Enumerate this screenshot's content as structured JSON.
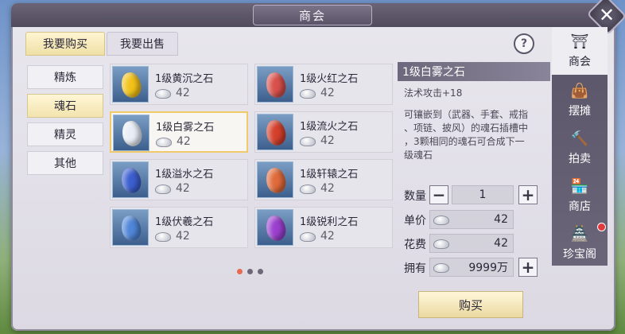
{
  "window": {
    "title": "商会",
    "close_icon": "close-icon"
  },
  "tabs": {
    "buy": "我要购买",
    "sell": "我要出售"
  },
  "help_label": "?",
  "categories": [
    {
      "label": "精炼",
      "active": false
    },
    {
      "label": "魂石",
      "active": true
    },
    {
      "label": "精灵",
      "active": false
    },
    {
      "label": "其他",
      "active": false
    }
  ],
  "items": [
    {
      "name": "1级黄沉之石",
      "price": "42",
      "gem_color": "#f2c21a"
    },
    {
      "name": "1级火红之石",
      "price": "42",
      "gem_color": "#d9504b"
    },
    {
      "name": "1级白雾之石",
      "price": "42",
      "gem_color": "#e8eef5",
      "selected": true
    },
    {
      "name": "1级流火之石",
      "price": "42",
      "gem_color": "#d5402c"
    },
    {
      "name": "1级溢水之石",
      "price": "42",
      "gem_color": "#3c5fd0"
    },
    {
      "name": "1级轩辕之石",
      "price": "42",
      "gem_color": "#e06a3a"
    },
    {
      "name": "1级伏羲之石",
      "price": "42",
      "gem_color": "#4f86d8"
    },
    {
      "name": "1级锐利之石",
      "price": "42",
      "gem_color": "#9a3fcf"
    }
  ],
  "pagination": {
    "pages": 3,
    "current": 1
  },
  "detail": {
    "title": "1级白雾之石",
    "attribute": "法术攻击+18",
    "description_lines": [
      "可镶嵌到（武器、手套、戒指",
      "、项链、披风）的魂石插槽中",
      "，3颗相同的魂石可合成下一",
      "级魂石"
    ],
    "quantity_label": "数量",
    "quantity": "1",
    "unit_price_label": "单价",
    "unit_price": "42",
    "cost_label": "花费",
    "cost": "42",
    "owned_label": "拥有",
    "owned": "9999万",
    "minus": "−",
    "plus": "+"
  },
  "buy_button": "购买",
  "side_nav": [
    {
      "label": "商会",
      "icon": "shop-counter-icon",
      "active": true
    },
    {
      "label": "摆摊",
      "icon": "stall-bag-icon",
      "active": false
    },
    {
      "label": "拍卖",
      "icon": "auction-icon",
      "active": false
    },
    {
      "label": "商店",
      "icon": "store-icon",
      "active": false
    },
    {
      "label": "珍宝阁",
      "icon": "treasure-pavilion-icon",
      "active": false,
      "badge": true
    }
  ],
  "colors": {
    "accent_gold": "#f0c96a",
    "selected_tab": "#efe0a6",
    "badge_red": "#e1393c",
    "page_dot_active": "#e86a50"
  }
}
